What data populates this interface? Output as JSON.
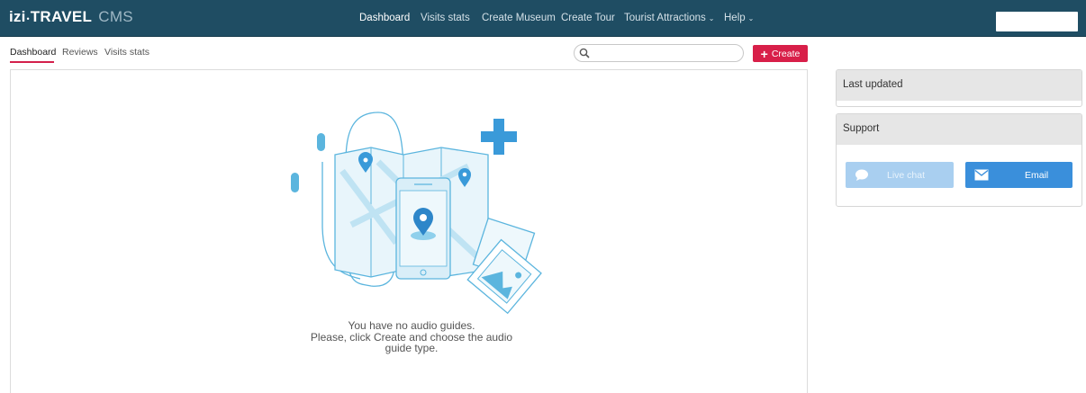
{
  "brand": {
    "izi": "izi",
    "dot": "•",
    "travel": "TRAVEL",
    "cms": "CMS"
  },
  "nav": {
    "items": [
      {
        "label": "Dashboard",
        "active": true
      },
      {
        "label": "Visits stats"
      },
      {
        "label": "Create Museum"
      },
      {
        "label": "Create Tour"
      },
      {
        "label": "Tourist Attractions",
        "caret": "⌄"
      },
      {
        "label": "Help",
        "caret": "⌄"
      }
    ]
  },
  "subtabs": [
    {
      "label": "Dashboard",
      "active": true
    },
    {
      "label": "Reviews"
    },
    {
      "label": "Visits stats"
    }
  ],
  "search": {
    "value": "",
    "placeholder": ""
  },
  "create_button": {
    "icon": "plus-icon",
    "label": "Create"
  },
  "empty_state": {
    "line1": "You have no audio guides.",
    "line2": "Please, click Create and choose the audio",
    "line3": "guide type."
  },
  "last_updated": {
    "title": "Last updated"
  },
  "support": {
    "title": "Support",
    "live_chat": {
      "label": "Live chat",
      "icon": "chat-bubble-icon"
    },
    "email": {
      "label": "Email",
      "icon": "envelope-icon"
    }
  },
  "colors": {
    "navbar": "#1f4d63",
    "accent": "#d81f49",
    "illustration": "#5bb5de",
    "email_button": "#3a8fdb",
    "live_chat_button": "#a9cff0"
  }
}
